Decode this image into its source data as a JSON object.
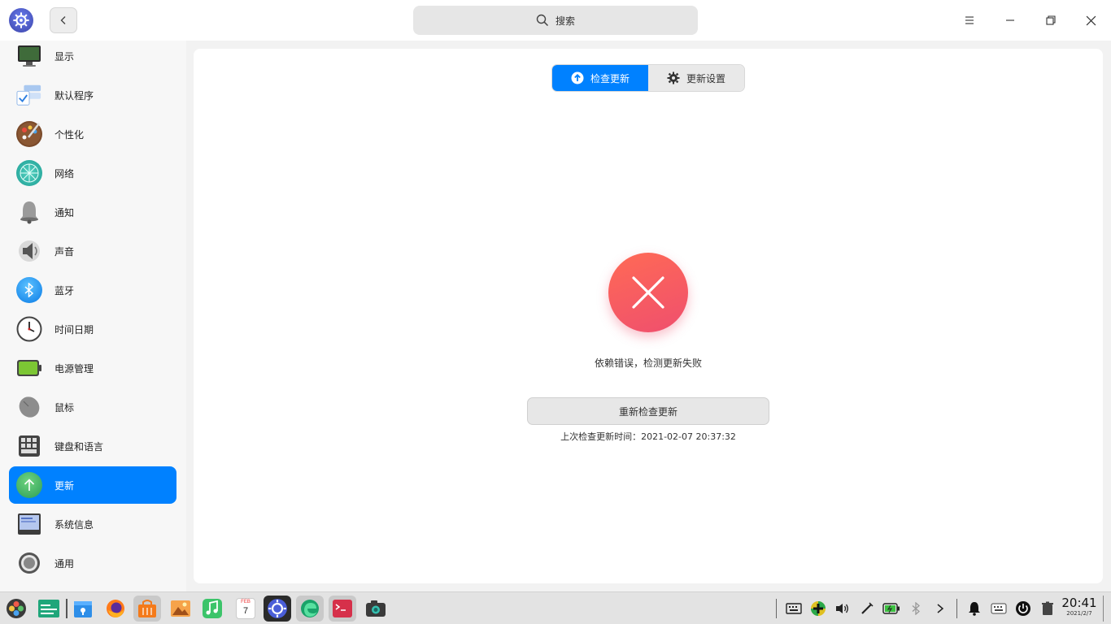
{
  "titlebar": {
    "search_placeholder": "搜索"
  },
  "sidebar": {
    "items": [
      {
        "label": "显示",
        "icon": "monitor-icon"
      },
      {
        "label": "默认程序",
        "icon": "default-apps-icon"
      },
      {
        "label": "个性化",
        "icon": "palette-icon"
      },
      {
        "label": "网络",
        "icon": "network-globe-icon"
      },
      {
        "label": "通知",
        "icon": "bell-icon"
      },
      {
        "label": "声音",
        "icon": "speaker-icon"
      },
      {
        "label": "蓝牙",
        "icon": "bluetooth-icon"
      },
      {
        "label": "时间日期",
        "icon": "clock-icon"
      },
      {
        "label": "电源管理",
        "icon": "battery-icon"
      },
      {
        "label": "鼠标",
        "icon": "mouse-icon"
      },
      {
        "label": "键盘和语言",
        "icon": "keyboard-icon"
      },
      {
        "label": "更新",
        "icon": "update-arrow-icon",
        "active": true
      },
      {
        "label": "系统信息",
        "icon": "system-info-icon"
      },
      {
        "label": "通用",
        "icon": "general-gear-icon"
      }
    ]
  },
  "update": {
    "tabs": [
      {
        "label": "检查更新",
        "icon": "arrow-up-circle-icon",
        "active": true
      },
      {
        "label": "更新设置",
        "icon": "gear-icon",
        "active": false
      }
    ],
    "error_message": "依赖错误，检测更新失败",
    "retry_label": "重新检查更新",
    "last_check": "上次检查更新时间：2021-02-07 20:37:32"
  },
  "taskbar": {
    "time": "20:41",
    "date": "2021/2/7",
    "calendar_month": "FEB",
    "calendar_day": "7"
  },
  "colors": {
    "accent": "#0081ff",
    "error_start": "#ff6a55",
    "error_end": "#ef4f6e"
  }
}
